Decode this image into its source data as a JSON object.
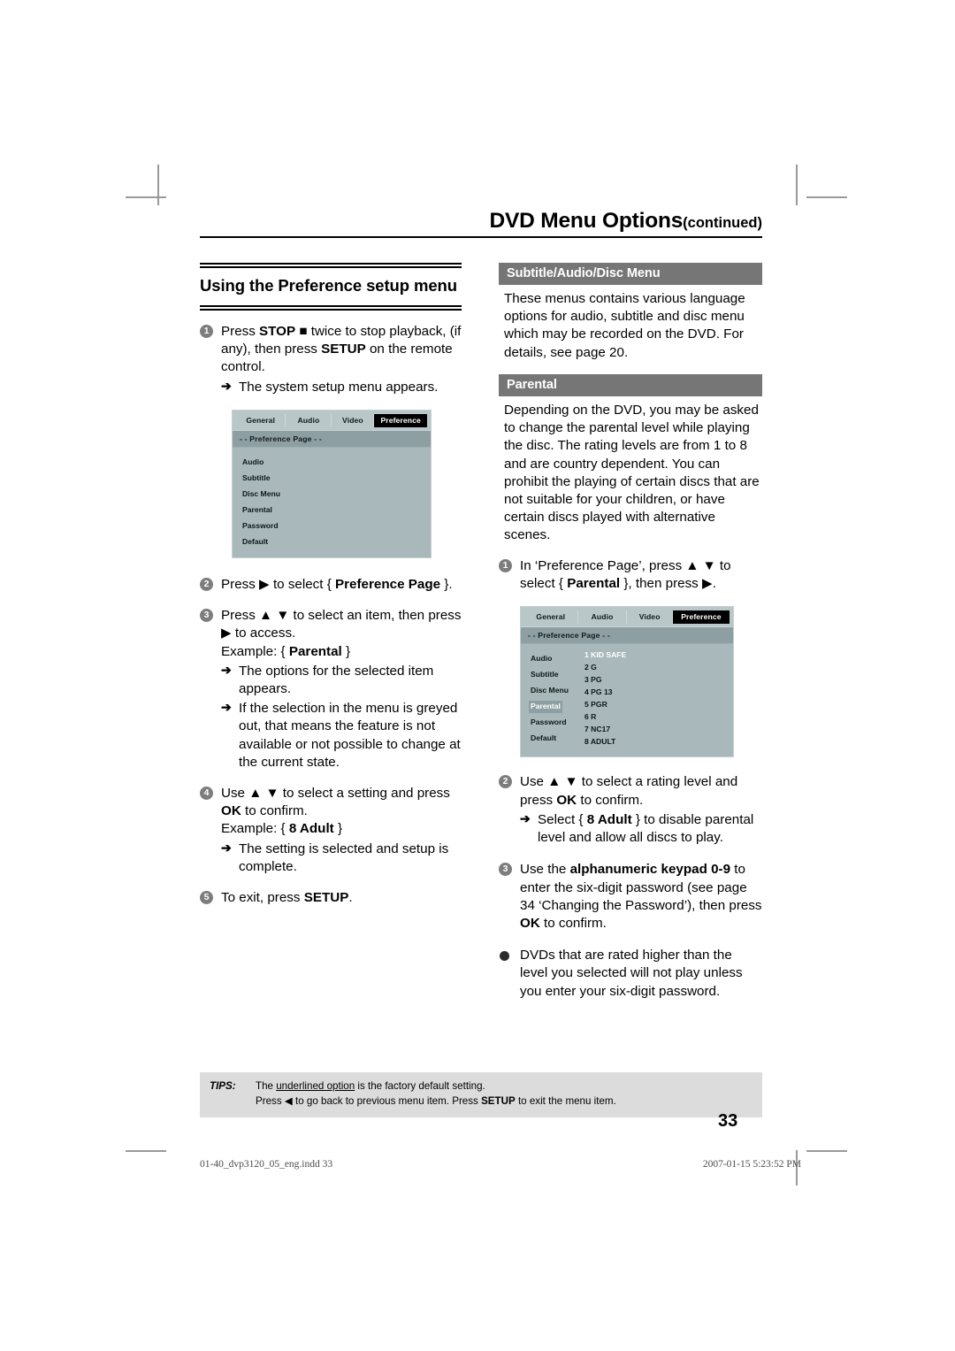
{
  "running_head": {
    "title": "DVD Menu Options",
    "continued": "(continued)"
  },
  "left_column": {
    "section_title": "Using the Preference setup menu",
    "steps": [
      {
        "num": "1",
        "text_parts": [
          {
            "t": "Press ",
            "b": false
          },
          {
            "t": "STOP",
            "b": true
          },
          {
            "t": " ■ twice to stop playback, (if any), then press ",
            "b": false
          },
          {
            "t": "SETUP",
            "b": true
          },
          {
            "t": " on the remote control.",
            "b": false
          }
        ],
        "arrows": [
          "The system setup menu appears."
        ]
      },
      {
        "num": "2",
        "text_parts": [
          {
            "t": "Press ▶ to select { ",
            "b": false
          },
          {
            "t": "Preference Page",
            "b": true
          },
          {
            "t": " }.",
            "b": false
          }
        ],
        "arrows": []
      },
      {
        "num": "3",
        "text_parts": [
          {
            "t": "Press ▲ ▼ to select an item, then press ▶ to access.",
            "b": false
          },
          {
            "t": "\nExample: { ",
            "b": false
          },
          {
            "t": "Parental",
            "b": true
          },
          {
            "t": " }",
            "b": false
          }
        ],
        "arrows": [
          "The options for the selected item appears.",
          "If the selection in the menu is greyed out, that means the feature is not available or not possible to change at the current state."
        ]
      },
      {
        "num": "4",
        "text_parts": [
          {
            "t": "Use ▲ ▼ to select a setting and press ",
            "b": false
          },
          {
            "t": "OK",
            "b": true
          },
          {
            "t": " to confirm.\nExample: { ",
            "b": false
          },
          {
            "t": "8 Adult",
            "b": true
          },
          {
            "t": " }",
            "b": false
          }
        ],
        "arrows": [
          "The setting is selected and setup is complete."
        ]
      },
      {
        "num": "5",
        "text_parts": [
          {
            "t": "To exit, press ",
            "b": false
          },
          {
            "t": "SETUP",
            "b": true
          },
          {
            "t": ".",
            "b": false
          }
        ],
        "arrows": []
      }
    ],
    "osd_menu": {
      "tabs": [
        "General",
        "Audio",
        "Video",
        "Preference"
      ],
      "active_tab": "Preference",
      "page_bar": "- -  Preference Page   - -",
      "items": [
        "Audio",
        "Subtitle",
        "Disc Menu",
        "Parental",
        "Password",
        "Default"
      ],
      "selected_item": "",
      "values": []
    }
  },
  "right_column": {
    "sections": [
      {
        "bar": "Subtitle/Audio/Disc Menu",
        "body": "These menus contains various language options for audio, subtitle and disc menu which may be recorded on the DVD. For details, see page 20."
      },
      {
        "bar": "Parental",
        "body": "Depending on the DVD, you may be asked to change the parental level while playing the disc. The rating levels are from 1 to 8 and are country dependent. You can prohibit the playing of certain discs that are not suitable for your children, or have certain discs played with alternative scenes."
      }
    ],
    "steps": [
      {
        "num": "1",
        "kind": "number",
        "text_parts": [
          {
            "t": "In ‘Preference Page’, press ▲ ▼ to select { ",
            "b": false
          },
          {
            "t": "Parental",
            "b": true
          },
          {
            "t": " }, then press ▶.",
            "b": false
          }
        ],
        "arrows": []
      },
      {
        "num": "2",
        "kind": "number",
        "text_parts": [
          {
            "t": "Use ▲ ▼ to select a rating level and press ",
            "b": false
          },
          {
            "t": "OK",
            "b": true
          },
          {
            "t": " to confirm.",
            "b": false
          }
        ],
        "arrows_rich": [
          [
            {
              "t": "Select { ",
              "b": false
            },
            {
              "t": "8 Adult",
              "b": true
            },
            {
              "t": " } to disable parental level and allow all discs to play.",
              "b": false
            }
          ]
        ]
      },
      {
        "num": "3",
        "kind": "number",
        "text_parts": [
          {
            "t": "Use the ",
            "b": false
          },
          {
            "t": "alphanumeric keypad 0-9",
            "b": true
          },
          {
            "t": " to enter the six-digit password (see page 34 ‘Changing the Password’), then press ",
            "b": false
          },
          {
            "t": "OK",
            "b": true
          },
          {
            "t": " to confirm.",
            "b": false
          }
        ],
        "arrows": []
      },
      {
        "num": "",
        "kind": "dot",
        "text_parts": [
          {
            "t": "DVDs that are rated higher than the level you selected will not play unless you enter your six-digit password.",
            "b": false
          }
        ],
        "arrows": []
      }
    ],
    "osd_menu": {
      "tabs": [
        "General",
        "Audio",
        "Video",
        "Preference"
      ],
      "active_tab": "Preference",
      "page_bar": "- -  Preference Page   - -",
      "items": [
        "Audio",
        "Subtitle",
        "Disc Menu",
        "Parental",
        "Password",
        "Default"
      ],
      "selected_item": "Parental",
      "values": [
        "1 KID SAFE",
        "2 G",
        "3 PG",
        "4 PG 13",
        "5 PGR",
        "6 R",
        "7 NC17",
        "8 ADULT"
      ],
      "selected_value": "1 KID SAFE"
    }
  },
  "tips": {
    "label": "TIPS:",
    "line1_pre": "The ",
    "line1_underline": "underlined option",
    "line1_post": " is the factory default setting.",
    "line2_pre": "Press ◀ to go back to previous menu item. Press ",
    "line2_bold": "SETUP",
    "line2_post": " to exit the menu item."
  },
  "page_number": "33",
  "footer": {
    "left": "01-40_dvp3120_05_eng.indd   33",
    "right": "2007-01-15   5:23:52 PM"
  }
}
